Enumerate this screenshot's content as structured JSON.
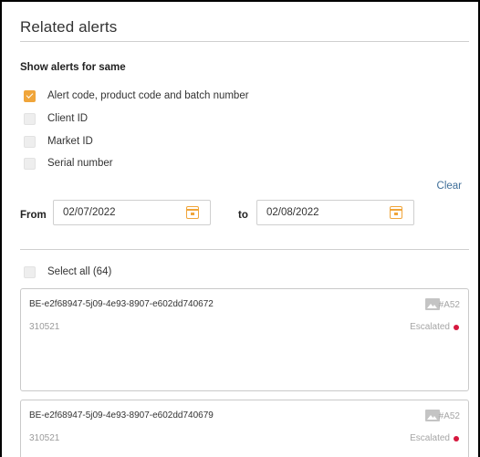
{
  "panel": {
    "title": "Related alerts",
    "subtitle": "Show alerts for same",
    "options": [
      {
        "label": "Alert code, product code and batch number",
        "checked": true
      },
      {
        "label": "Client ID",
        "checked": false
      },
      {
        "label": "Market ID",
        "checked": false
      },
      {
        "label": "Serial number",
        "checked": false
      }
    ],
    "clear_label": "Clear"
  },
  "date_range": {
    "from_label": "From",
    "from_value": "02/07/2022",
    "to_label": "to",
    "to_value": "02/08/2022"
  },
  "list": {
    "select_all_label": "Select all (64)",
    "select_all_checked": false,
    "alerts": [
      {
        "id": "BE-e2f68947-5j09-4e93-8907-e602dd740672",
        "code": "310521",
        "ref": "#A52",
        "status": "Escalated"
      },
      {
        "id": "BE-e2f68947-5j09-4e93-8907-e602dd740679",
        "code": "310521",
        "ref": "#A52",
        "status": "Escalated"
      }
    ]
  },
  "colors": {
    "accent": "#f0a53a",
    "link": "#3f6f99",
    "escalated_dot": "#d6183e"
  },
  "icons": {
    "checkbox_checked": "check-icon",
    "date_picker": "calendar-icon",
    "attachment": "image-icon",
    "status_indicator": "status-dot-icon"
  }
}
